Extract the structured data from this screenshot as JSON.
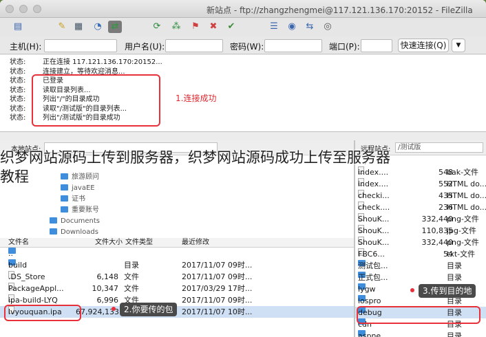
{
  "window": {
    "title": "新站点 - ftp://zhangzhengmei@117.121.136.170:20152 - FileZilla"
  },
  "quickconnect": {
    "host_label": "主机(H):",
    "user_label": "用户名(U):",
    "pass_label": "密码(W):",
    "port_label": "端口(P):",
    "connect_button": "快速连接(Q)",
    "dropdown_glyph": "▼"
  },
  "log": {
    "rows": [
      {
        "k": "状态:",
        "v": "正在连接 117.121.136.170:20152..."
      },
      {
        "k": "状态:",
        "v": "连接建立，等待欢迎消息..."
      },
      {
        "k": "状态:",
        "v": "已登录"
      },
      {
        "k": "状态:",
        "v": "读取目录列表..."
      },
      {
        "k": "状态:",
        "v": "列出\"/\"的目录成功"
      },
      {
        "k": "状态:",
        "v": "读取\"/测试版\"的目录列表..."
      },
      {
        "k": "状态:",
        "v": "列出\"/测试版\"的目录成功"
      }
    ],
    "annotation": "1.连接成功"
  },
  "overlay_text": {
    "line1": "织梦网站源码上传到服务器，织梦网站源码成功上传至服务器",
    "line2": "教程"
  },
  "local": {
    "site_label": "本地站点:",
    "tree": [
      {
        "label": "旅游顾问",
        "indent": 1
      },
      {
        "label": "javaEE",
        "indent": 1
      },
      {
        "label": "证书",
        "indent": 1
      },
      {
        "label": "重要账号",
        "indent": 1
      },
      {
        "label": "Documents",
        "indent": 0
      },
      {
        "label": "Downloads",
        "indent": 0
      }
    ],
    "columns": {
      "name": "文件名",
      "size": "文件大小",
      "type": "文件类型",
      "modified": "最近修改"
    },
    "files": [
      {
        "name": "..",
        "size": "",
        "type": "",
        "modified": "",
        "kind": "folder"
      },
      {
        "name": "build",
        "size": "",
        "type": "目录",
        "modified": "2017/11/07 09时...",
        "kind": "folder"
      },
      {
        "name": ".DS_Store",
        "size": "6,148",
        "type": "文件",
        "modified": "2017/11/07 09时...",
        "kind": "file"
      },
      {
        "name": "PackageAppl...",
        "size": "10,347",
        "type": "文件",
        "modified": "2017/03/29 17时...",
        "kind": "file"
      },
      {
        "name": "ipa-build-LYQ",
        "size": "6,996",
        "type": "文件",
        "modified": "2017/11/07 09时...",
        "kind": "file"
      },
      {
        "name": "lvyouquan.ipa",
        "size": "67,924,133",
        "type": "文件",
        "modified": "2017/11/07 10时...",
        "kind": "file"
      }
    ],
    "annotation": "2.你要传的包"
  },
  "remote": {
    "site_label": "远程站点:",
    "path": "/测试版",
    "top_item": "/",
    "files": [
      {
        "name": "index....",
        "size": "548",
        "type": "bak-文件",
        "kind": "file"
      },
      {
        "name": "index....",
        "size": "552",
        "type": "HTML do...",
        "kind": "file"
      },
      {
        "name": "checki...",
        "size": "435",
        "type": "HTML do...",
        "kind": "file"
      },
      {
        "name": "check....",
        "size": "236",
        "type": "HTML do...",
        "kind": "file"
      },
      {
        "name": "ShouK...",
        "size": "332,440",
        "type": "png-文件",
        "kind": "file"
      },
      {
        "name": "ShouK...",
        "size": "110,835",
        "type": "jpg-文件",
        "kind": "file"
      },
      {
        "name": "ShouK...",
        "size": "332,440",
        "type": "png-文件",
        "kind": "file"
      },
      {
        "name": "FBC6...",
        "size": "54",
        "type": "txt-文件",
        "kind": "file"
      },
      {
        "name": "测试包...",
        "size": "",
        "type": "目录",
        "kind": "folder"
      },
      {
        "name": "正式包...",
        "size": "",
        "type": "目录",
        "kind": "folder"
      },
      {
        "name": "lygw",
        "size": "",
        "type": "目录",
        "kind": "folder"
      },
      {
        "name": "iospro",
        "size": "",
        "type": "目录",
        "kind": "folder"
      },
      {
        "name": "debug",
        "size": "",
        "type": "目录",
        "kind": "folder"
      },
      {
        "name": "cdn",
        "size": "",
        "type": "目录",
        "kind": "folder"
      },
      {
        "name": "aspne...",
        "size": "",
        "type": "目录",
        "kind": "folder"
      }
    ],
    "annotation": "3.传到目的地"
  },
  "colors": {
    "accent": "#e8303a",
    "folder": "#3f8ede",
    "selected": "#cfe0f5"
  }
}
